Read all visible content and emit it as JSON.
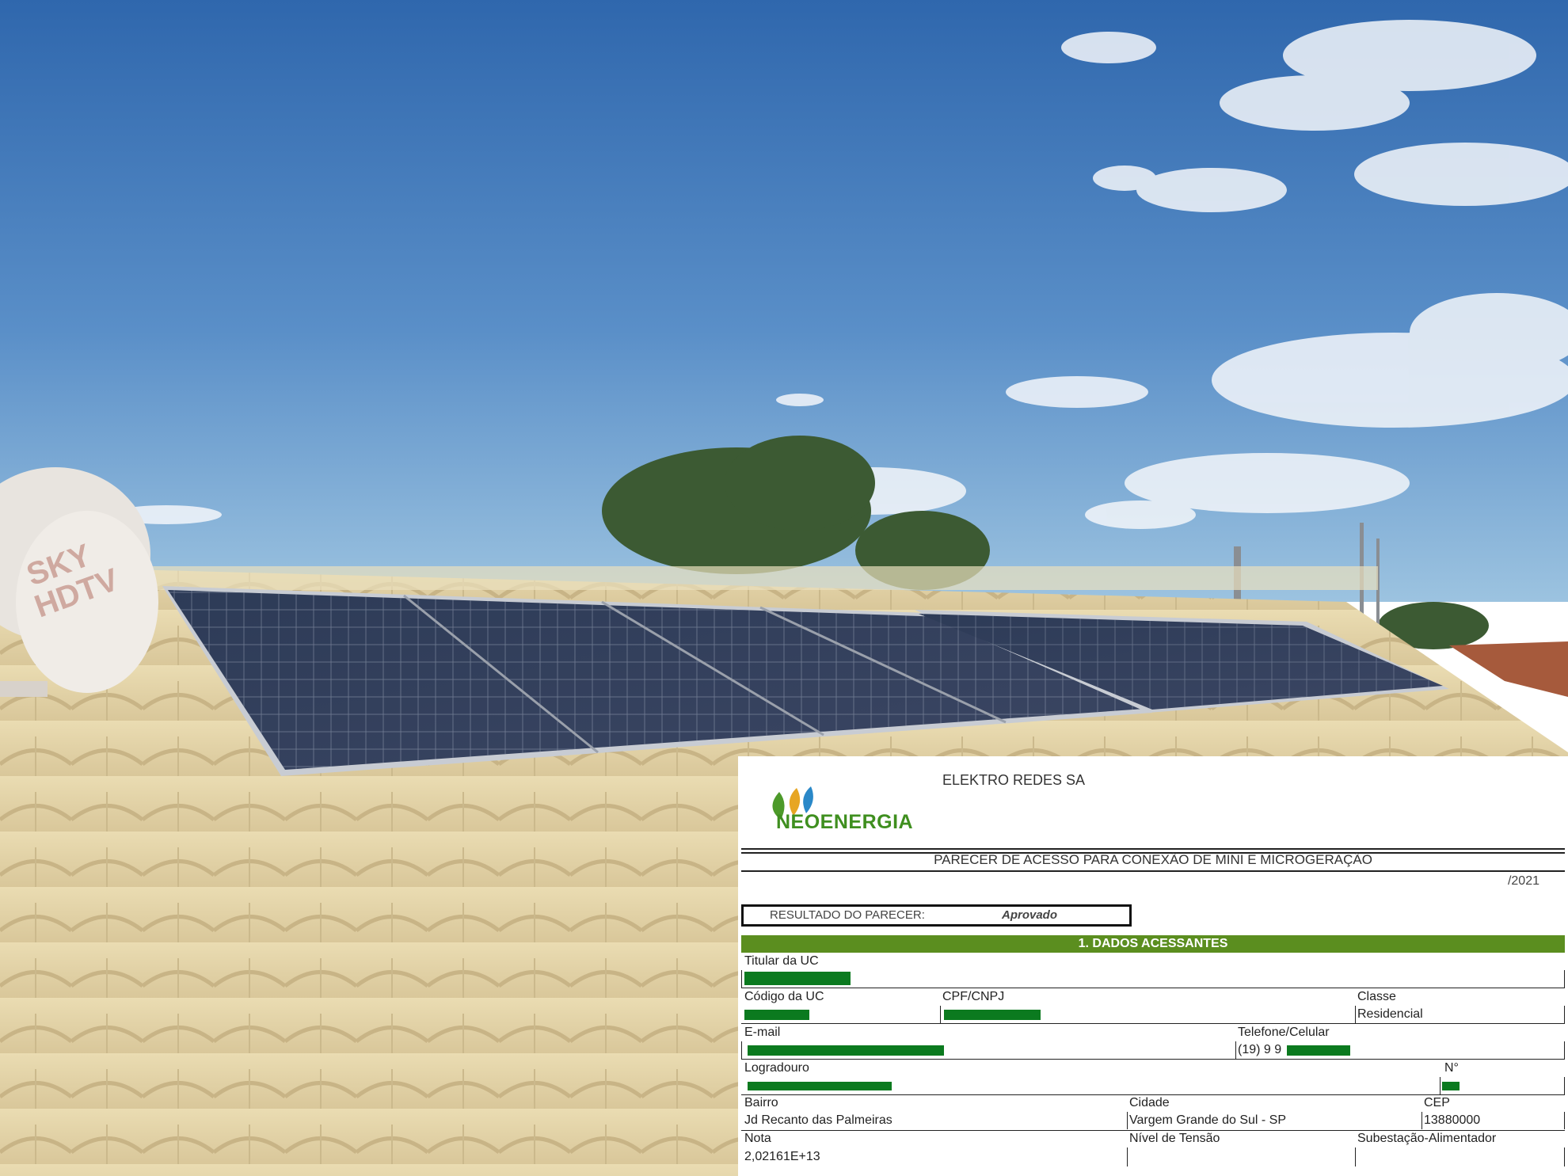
{
  "photo": {
    "sky_top": "#2f67ad",
    "sky_bottom": "#86b4d8",
    "roof_color": "#e3d4a6",
    "panel_color": "#2b3549",
    "dish_text": "SKY HDTV"
  },
  "doc": {
    "company": "ELEKTRO REDES SA",
    "logo_text": "NEOENERGIA",
    "title": "PARECER DE ACESSO PARA CONEXÃO DE MINI E MICROGERAÇÃO",
    "date": "/2021",
    "result_label": "RESULTADO DO PARECER:",
    "result_value": "Aprovado",
    "section1": "1. DADOS ACESSANTES",
    "fields": {
      "titular_label": "Titular da UC",
      "titular_value": "",
      "codigo_label": "Código da UC",
      "cpf_label": "CPF/CNPJ",
      "classe_label": "Classe",
      "classe_value": "Residencial",
      "email_label": "E-mail",
      "telefone_label": "Telefone/Celular",
      "telefone_value": "(19) 9 9",
      "logradouro_label": "Logradouro",
      "numero_label": "N°",
      "bairro_label": "Bairro",
      "bairro_value": "Jd Recanto das Palmeiras",
      "cidade_label": "Cidade",
      "cidade_value": "Vargem Grande do Sul - SP",
      "cep_label": "CEP",
      "cep_value": "13880000",
      "nota_label": "Nota",
      "nota_value": "2,02161E+13",
      "nivel_label": "Nível de Tensão",
      "subestacao_label": "Subestação-Alimentador"
    },
    "colors": {
      "brand_green": "#5b8e1f",
      "redaction": "#0b7a1f"
    }
  }
}
